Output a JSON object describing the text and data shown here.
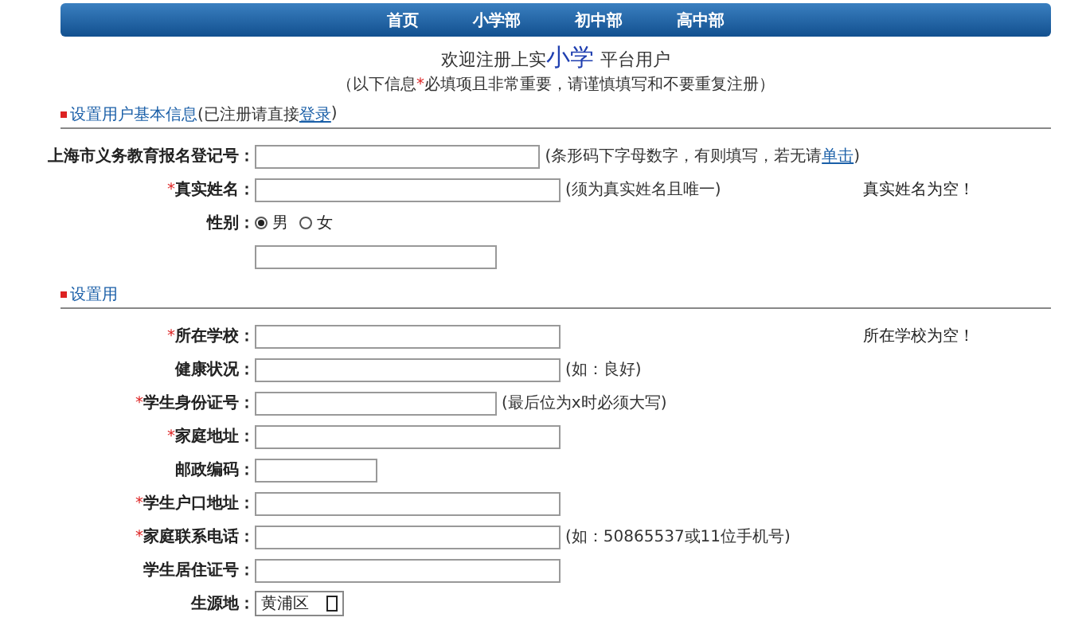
{
  "nav": [
    {
      "label": "首页"
    },
    {
      "label": "小学部"
    },
    {
      "label": "初中部"
    },
    {
      "label": "高中部"
    }
  ],
  "heading": {
    "before": "欢迎注册上实",
    "highlight": "小学",
    "after": "平台用户",
    "note_before": "（以下信息",
    "note_star": "*",
    "note_after": "必填项且非常重要，请谨慎填写和不要重复注册）"
  },
  "sections": [
    {
      "title": "设置用户基本信息",
      "aside": "(已注册请直接",
      "aside_link": "登录",
      "aside_end": ")",
      "rows": [
        {
          "kind": "long-field",
          "label": "上海市义务教育报名登记号：",
          "required": false,
          "hint": "(条形码下字母数字，有则填写，若无请",
          "hint_link": "单击",
          "hint_end": ")"
        },
        {
          "kind": "long-field",
          "label": "真实姓名：",
          "required": true,
          "hint": "(须为真实姓名且唯一)",
          "error": "真实姓名为空！"
        },
        {
          "kind": "radio",
          "label": "性别：",
          "required": false,
          "options": [
            {
              "label": "男",
              "selected": true
            },
            {
              "label": "女",
              "selected": false
            }
          ]
        },
        {
          "kind": "medium-field"
        }
      ]
    },
    {
      "title": "设置用",
      "rows": [
        {
          "kind": "long-field",
          "label": "所在学校：",
          "required": true,
          "error": "所在学校为空！"
        },
        {
          "kind": "long-field",
          "label": "健康状况：",
          "required": false,
          "hint": "(如：良好)"
        },
        {
          "kind": "medium-field",
          "label": "学生身份证号：",
          "required": true,
          "hint": "(最后位为x时必须大写)"
        },
        {
          "kind": "long-field",
          "label": "家庭地址：",
          "required": true
        },
        {
          "kind": "short-field",
          "label": "邮政编码：",
          "required": false
        },
        {
          "kind": "long-field",
          "label": "学生户口地址：",
          "required": true
        },
        {
          "kind": "long-field",
          "label": "家庭联系电话：",
          "required": true,
          "hint": "(如：50865537或11位手机号)"
        },
        {
          "kind": "long-field",
          "label": "学生居住证号：",
          "required": false
        },
        {
          "kind": "select",
          "label": "生源地：",
          "required": false,
          "value": "黄浦区"
        }
      ]
    }
  ]
}
